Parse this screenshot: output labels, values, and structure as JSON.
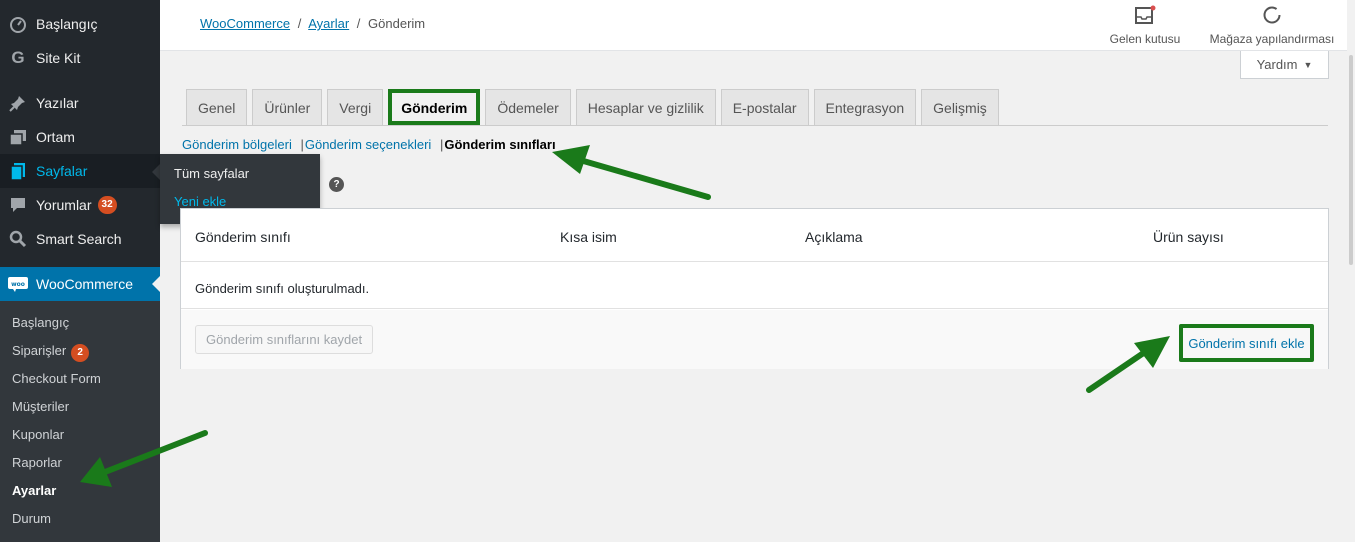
{
  "sidebar": {
    "items": [
      {
        "label": "Başlangıç",
        "icon": "dashboard-icon"
      },
      {
        "label": "Site Kit",
        "icon": "google-g-icon"
      },
      {
        "label": "Yazılar",
        "icon": "pin-icon"
      },
      {
        "label": "Ortam",
        "icon": "media-icon"
      },
      {
        "label": "Sayfalar",
        "icon": "pages-icon"
      },
      {
        "label": "Yorumlar",
        "icon": "comment-icon",
        "badge": "32"
      },
      {
        "label": "Smart Search",
        "icon": "search-icon"
      },
      {
        "label": "WooCommerce",
        "icon": "woo-icon"
      }
    ],
    "woo_submenu": [
      {
        "label": "Başlangıç"
      },
      {
        "label": "Siparişler",
        "badge": "2"
      },
      {
        "label": "Checkout Form"
      },
      {
        "label": "Müşteriler"
      },
      {
        "label": "Kuponlar"
      },
      {
        "label": "Raporlar"
      },
      {
        "label": "Ayarlar"
      },
      {
        "label": "Durum"
      }
    ],
    "flyout": {
      "item1": "Tüm sayfalar",
      "item2": "Yeni ekle"
    }
  },
  "header": {
    "breadcrumb": {
      "part1": "WooCommerce",
      "sep1": "/",
      "part2": "Ayarlar",
      "sep2": "/",
      "part3": "Gönderim"
    },
    "inbox_label": "Gelen kutusu",
    "setup_label": "Mağaza yapılandırması",
    "help_label": "Yardım"
  },
  "tabs": [
    "Genel",
    "Ürünler",
    "Vergi",
    "Gönderim",
    "Ödemeler",
    "Hesaplar ve gizlilik",
    "E-postalar",
    "Entegrasyon",
    "Gelişmiş"
  ],
  "subsub": {
    "zones": "Gönderim bölgeleri",
    "options": "Gönderim seçenekleri",
    "classes": "Gönderim sınıfları",
    "sep": "|"
  },
  "help_icon": "?",
  "table": {
    "headers": [
      "Gönderim sınıfı",
      "Kısa isim",
      "Açıklama",
      "Ürün sayısı"
    ],
    "empty_message": "Gönderim sınıfı oluşturulmadı.",
    "save_button": "Gönderim sınıflarını kaydet",
    "add_button": "Gönderim sınıfı ekle"
  },
  "colors": {
    "annotation_green": "#1a7a1a",
    "wp_blue": "#0073aa",
    "sidebar_dark": "#23282d"
  }
}
